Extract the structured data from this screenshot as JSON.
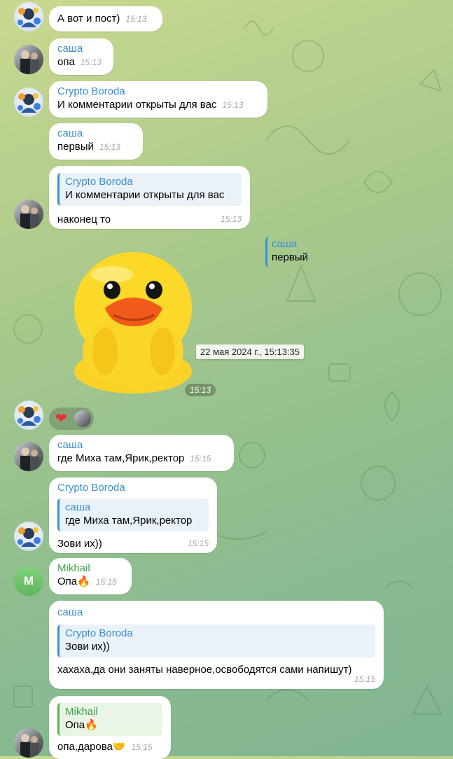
{
  "background_color": "#a9c98c",
  "messages": [
    {
      "text": "А вот и пост)",
      "time": "15:13"
    },
    {
      "sender": "саша",
      "text": "опа",
      "time": "15:13"
    },
    {
      "sender": "Crypto Boroda",
      "text": "И комментарии открыты для вас",
      "time": "15:13"
    },
    {
      "sender": "саша",
      "text": "первый",
      "time": "15:13"
    },
    {
      "sender": "Crypto Boroda",
      "quote_text": "И комментарии открыты для вас",
      "text": "наконец то",
      "time": "15:13"
    },
    {
      "quote_sender": "саша",
      "quote_text": "первый"
    },
    {
      "sticker": "duck-sticker",
      "time": "15:13",
      "date_tooltip": "22 мая 2024 г., 15:13:35"
    },
    {
      "reaction": "❤",
      "reaction_icon": "heart-icon"
    },
    {
      "sender": "саша",
      "text": "где Миха там,Ярик,ректор",
      "time": "15:15"
    },
    {
      "sender": "Crypto Boroda",
      "quote_sender": "саша",
      "quote_text": "где Миха там,Ярик,ректор",
      "text": "Зови их))",
      "time": "15:15"
    },
    {
      "sender": "Mikhail",
      "text": "Опа🔥",
      "time": "15:15"
    },
    {
      "sender": "саша",
      "quote_sender": "Crypto Boroda",
      "quote_text": "Зови их))",
      "text": "хахаха,да они заняты наверное,освободятся сами напишут)",
      "time": "15:15"
    },
    {
      "quote_sender": "Mikhail",
      "quote_text": "Опа🔥",
      "text": "опа,дарова🤝",
      "time": "15:15"
    }
  ],
  "avatars": {
    "mikhail_initial": "M"
  }
}
